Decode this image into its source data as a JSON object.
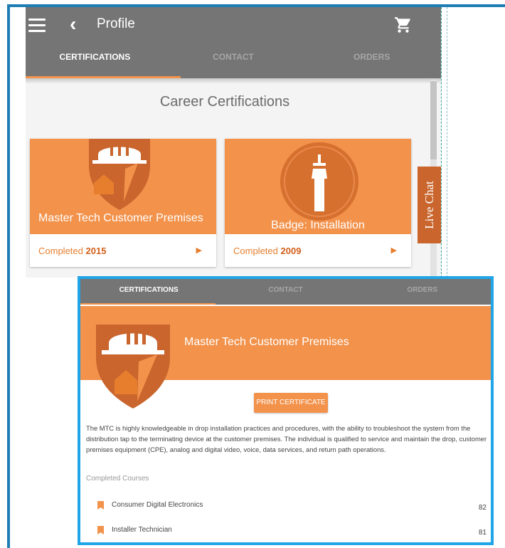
{
  "app": {
    "title": "Profile",
    "icons": [
      "menu-icon",
      "back-chevron-icon",
      "cart-icon",
      "play-arrow-icon",
      "bookmark-icon"
    ]
  },
  "tabs": [
    {
      "label": "CERTIFICATIONS",
      "active": true
    },
    {
      "label": "CONTACT",
      "active": false
    },
    {
      "label": "ORDERS",
      "active": false
    }
  ],
  "career": {
    "heading": "Career Certifications",
    "cards": [
      {
        "name": "Master Tech Customer Premises",
        "completed_prefix": "Completed",
        "year": "2015"
      },
      {
        "name": "Badge: Installation",
        "completed_prefix": "Completed",
        "year": "2009"
      }
    ]
  },
  "live_chat": {
    "label": "Live Chat"
  },
  "detail": {
    "title": "Master Tech Customer Premises",
    "print_button": "PRINT CERTIFICATE",
    "description": "The MTC is highly knowledgeable in drop installation practices and procedures, with the ability to troubleshoot the system from the distribution tap to the terminating device at the customer premises. The individual is qualified to service and maintain the drop, customer premises equipment (CPE), analog and digital video, voice, data services, and return path operations.",
    "completed_courses_label": "Completed Courses",
    "courses": [
      {
        "name": "Consumer Digital Electronics",
        "score": "82"
      },
      {
        "name": "Installer Technician",
        "score": "81"
      }
    ]
  },
  "colors": {
    "accent": "#f2924b",
    "accent_dark": "#d35f1a",
    "appbar": "#757575",
    "frame_blue": "#1e7db4",
    "highlight_blue": "#1fa5e8",
    "live_chat": "#c9652d"
  }
}
